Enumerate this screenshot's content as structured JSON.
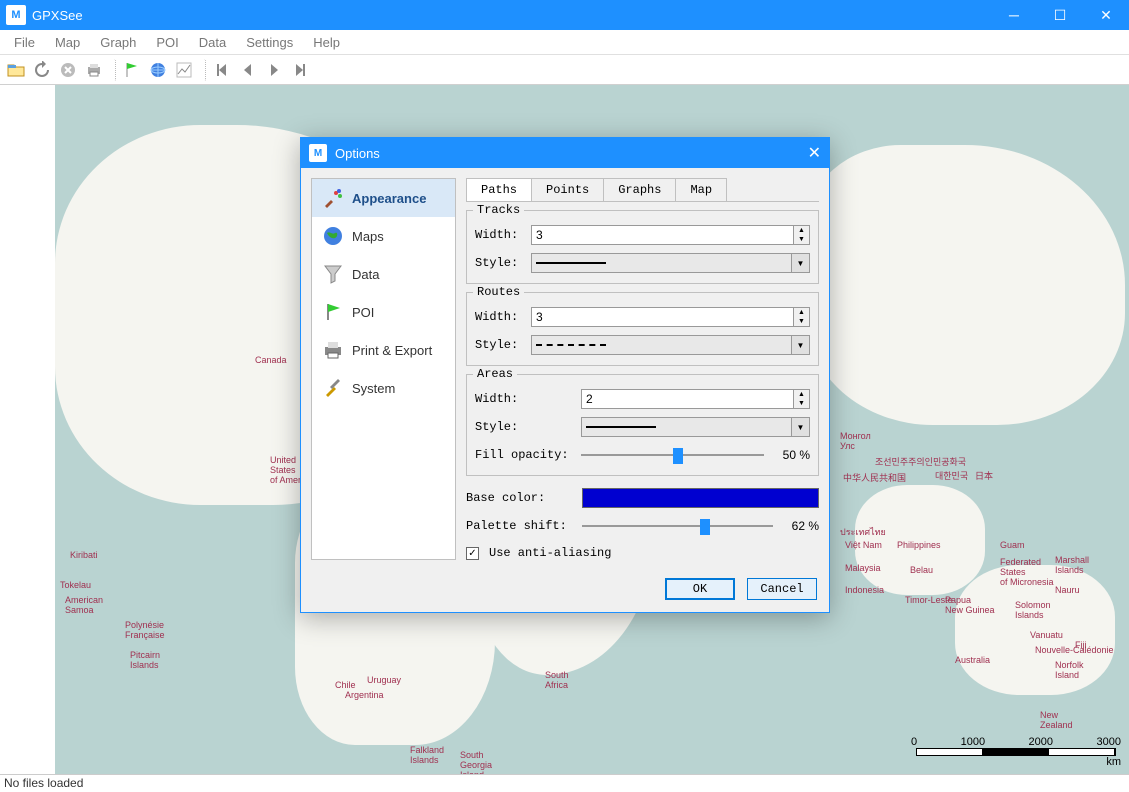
{
  "window": {
    "title": "GPXSee"
  },
  "menu": [
    "File",
    "Map",
    "Graph",
    "POI",
    "Data",
    "Settings",
    "Help"
  ],
  "status": "No files loaded",
  "scale": {
    "ticks": [
      "0",
      "1000",
      "2000",
      "3000"
    ],
    "unit": "km"
  },
  "dialog": {
    "title": "Options",
    "nav": [
      "Appearance",
      "Maps",
      "Data",
      "POI",
      "Print & Export",
      "System"
    ],
    "tabs": [
      "Paths",
      "Points",
      "Graphs",
      "Map"
    ],
    "tracks": {
      "legend": "Tracks",
      "width_label": "Width:",
      "width": "3",
      "style_label": "Style:"
    },
    "routes": {
      "legend": "Routes",
      "width_label": "Width:",
      "width": "3",
      "style_label": "Style:"
    },
    "areas": {
      "legend": "Areas",
      "width_label": "Width:",
      "width": "2",
      "style_label": "Style:",
      "fill_label": "Fill opacity:",
      "fill_value": "50 %"
    },
    "base_color_label": "Base color:",
    "base_color": "#0000d0",
    "palette_label": "Palette shift:",
    "palette_value": "62 %",
    "aa_label": "Use anti-aliasing",
    "aa_checked": true,
    "ok": "OK",
    "cancel": "Cancel"
  },
  "map_labels": {
    "canada": "Canada",
    "usa": "United\nStates\nof America",
    "kiribati": "Kiribati",
    "tokelau": "Tokelau",
    "samoa": "American\nSamoa",
    "pf": "Polynésie\nFrançaise",
    "pitcairn": "Pitcairn\nIslands",
    "chile": "Chile",
    "uruguay": "Uruguay",
    "argentina": "Argentina",
    "falkland": "Falkland\nIslands",
    "sgeorgia": "South\nGeorgia\nIsland",
    "safrica": "South\nAfrica",
    "mongolia": "Монгол\nУлс",
    "korea": "조선민주주의인민공화국",
    "china": "中华人民共和国",
    "skorea": "대한민국",
    "japan": "日本",
    "vietnam": "Việt Nam",
    "philippines": "Philippines",
    "malaysia": "Malaysia",
    "belau": "Belau",
    "indonesia": "Indonesia",
    "guam": "Guam",
    "micronesia": "Federated\nStates\nof Micronesia",
    "marshall": "Marshall\nIslands",
    "nauru": "Nauru",
    "png": "Papua\nNew Guinea",
    "solomon": "Solomon\nIslands",
    "vanuatu": "Vanuatu",
    "newcal": "Nouvelle-Calédonie",
    "fiji": "Fiji",
    "australia": "Australia",
    "nz": "New\nZealand",
    "norfolk": "Norfolk\nIsland",
    "tl": "Timor-Leste",
    "thailand": "ประเทศไทย"
  }
}
